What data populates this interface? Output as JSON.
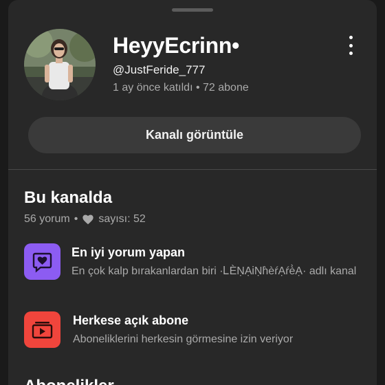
{
  "channel": {
    "name": "HeyyEcrinn•",
    "handle": "@JustFeride_777",
    "meta": "1 ay önce katıldı • 72 abone",
    "view_button": "Kanalı görüntüle"
  },
  "section": {
    "title": "Bu kanalda",
    "comments": "56 yorum",
    "separator": "•",
    "hearts": "sayısı: 52"
  },
  "badges": [
    {
      "title": "En iyi yorum yapan",
      "desc": "En çok kalp bırakanlardan biri ·ᏞÈṆẠᎥṆh̀èŕẠŕè̀Ạ· adlı kanal",
      "icon": "heart-comment-icon",
      "color": "#8c5cf2"
    },
    {
      "title": "Herkese açık abone",
      "desc": "Aboneliklerini herkesin görmesine izin veriyor",
      "icon": "subscriptions-icon",
      "color": "#f0453c"
    }
  ],
  "next_section_title": "Abonelikler"
}
